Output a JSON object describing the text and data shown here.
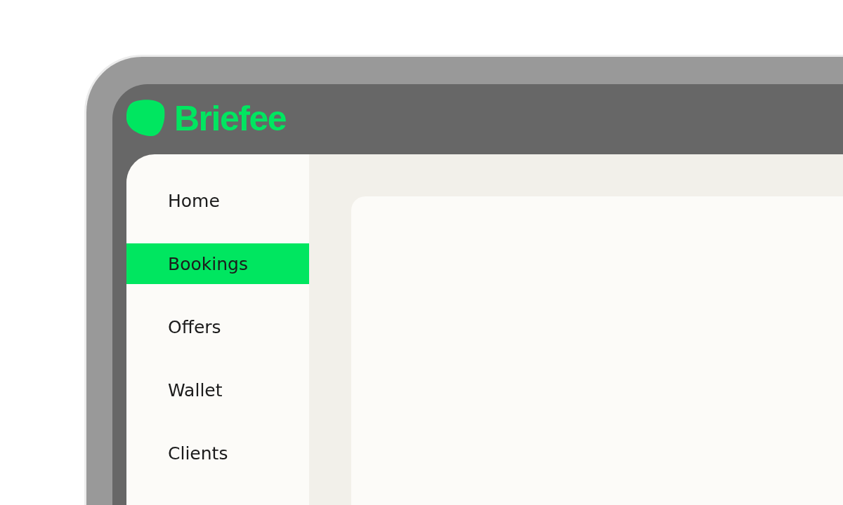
{
  "brand": {
    "name": "Briefee"
  },
  "nav": {
    "items": [
      {
        "label": "Home",
        "selected": false
      },
      {
        "label": "Bookings",
        "selected": true
      },
      {
        "label": "Offers",
        "selected": false
      },
      {
        "label": "Wallet",
        "selected": false
      },
      {
        "label": "Clients",
        "selected": false
      }
    ]
  }
}
